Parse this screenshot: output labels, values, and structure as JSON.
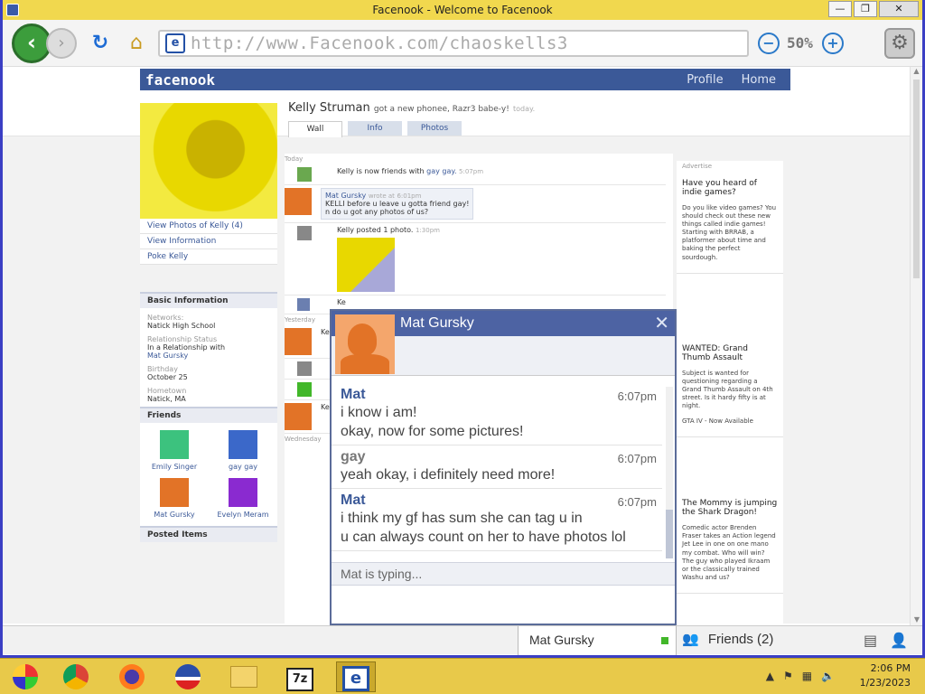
{
  "window": {
    "title": "Facenook - Welcome to Facenook",
    "minimize": "—",
    "maximize": "❐",
    "close": "✕"
  },
  "toolbar": {
    "url": "http://www.Facenook.com/chaoskells3",
    "zoom": "50%"
  },
  "fb": {
    "logo": "facenook",
    "nav": [
      "Profile",
      "Home"
    ]
  },
  "profile": {
    "name": "Kelly Struman",
    "status": "got a new phonee, Razr3 babe-y!",
    "status_time": "today.",
    "tabs": [
      "Wall",
      "Info",
      "Photos"
    ],
    "links": [
      "View Photos of Kelly (4)",
      "View Information",
      "Poke Kelly"
    ],
    "basic_head": "Basic Information",
    "info": {
      "networks_label": "Networks:",
      "networks_value": "Natick High School",
      "rel_label": "Relationship Status",
      "rel_value": "In a Relationship with",
      "rel_link": "Mat Gursky",
      "birthday_label": "Birthday",
      "birthday_value": "October 25",
      "hometown_label": "Hometown",
      "hometown_value": "Natick, MA"
    },
    "friends_head": "Friends",
    "friends": [
      "Emily Singer",
      "gay gay",
      "Mat Gursky",
      "Evelyn Meram"
    ],
    "posted_items": "Posted Items"
  },
  "wall": {
    "day_today": "Today",
    "day_yesterday": "Yesterday",
    "day_wednesday": "Wednesday",
    "item1_text": "Kelly is now friends with",
    "item1_link": "gay gay.",
    "item1_time": "5:07pm",
    "item2_name": "Mat Gursky",
    "item2_wrote": "wrote at",
    "item2_time": "6:01pm",
    "item2_l1": "KELLI before u leave u gotta friend gay!",
    "item2_l2": "n do u got any photos of us?",
    "item3_text": "Kelly posted 1 photo.",
    "item3_time": "1:30pm",
    "item4_text": "Ke",
    "item5_text": "Ke",
    "item6_text": "Ke",
    "item7_text": "Ke",
    "item8_text": "Ke"
  },
  "ads": {
    "label": "Advertise",
    "ad1_title": "Have you heard of indie games?",
    "ad1_body": "Do you like video games? You should check out these new things called indie games! Starting with BRRAB, a platformer about time and baking the perfect sourdough.",
    "ad2_title": "WANTED: Grand Thumb Assault",
    "ad2_body": "Subject is wanted for questioning regarding a Grand Thumb Assault on 4th street. Is it hardy fifty is at night.",
    "ad2_extra": "GTA IV - Now Available",
    "ad3_title": "The Mommy is jumping the Shark Dragon!",
    "ad3_body": "Comedic actor Brenden Fraser takes an Action legend Jet Lee in one on one mano my combat. Who will win? The guy who played Ikraam or the classically trained Washu and us?"
  },
  "chat": {
    "name": "Mat Gursky",
    "messages": [
      {
        "who": "Mat",
        "time": "6:07pm",
        "l1": "i know i am!",
        "l2": "okay, now for some pictures!"
      },
      {
        "who": "gay",
        "time": "6:07pm",
        "l1": "yeah okay, i definitely need more!",
        "l2": ""
      },
      {
        "who": "Mat",
        "time": "6:07pm",
        "l1": "i think my gf has sum she can tag u in",
        "l2": "u can always count on her to have photos lol"
      }
    ],
    "typing": "Mat is typing..."
  },
  "chatbar": {
    "tab": "Mat Gursky",
    "friends": "Friends (2)"
  },
  "taskbar": {
    "time": "2:06 PM",
    "date": "1/23/2023",
    "apps": [
      "pal-icon",
      "chrome-icon",
      "firefox-icon",
      "obama-icon",
      "folder-icon",
      "7zip-icon",
      "ie-icon"
    ]
  },
  "colors": {
    "fb_blue": "#3b5998",
    "titlebar": "#f1d84e",
    "taskbar": "#e8c94a",
    "border": "#3b3fc4"
  }
}
